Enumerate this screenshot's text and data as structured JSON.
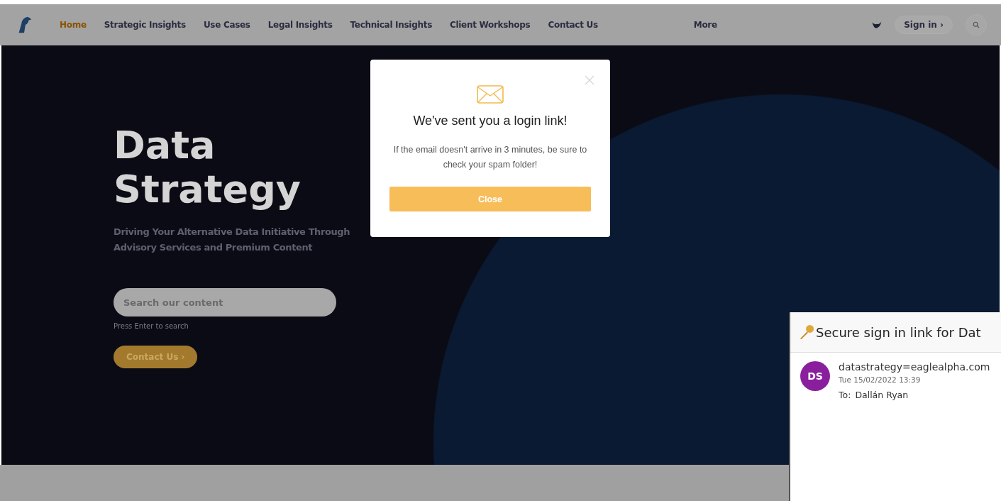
{
  "nav": {
    "items": [
      {
        "label": "Home",
        "selected": true
      },
      {
        "label": "Strategic Insights",
        "selected": false
      },
      {
        "label": "Use Cases",
        "selected": false
      },
      {
        "label": "Legal Insights",
        "selected": false
      },
      {
        "label": "Technical Insights",
        "selected": false
      },
      {
        "label": "Client Workshops",
        "selected": false
      },
      {
        "label": "Contact Us",
        "selected": false
      },
      {
        "label": "More",
        "selected": false
      }
    ],
    "sign_in": "Sign in ›"
  },
  "hero": {
    "title_lines": [
      "Data",
      "Strategy"
    ],
    "subtitle": "Driving Your Alternative Data Initiative Through Advisory Services and Premium Content",
    "search": {
      "placeholder": "Search our content"
    },
    "search_hint": "Press Enter to search",
    "contact_button": "Contact Us ›"
  },
  "modal": {
    "title": "We've sent you a login link!",
    "message": "If the email doesn't arrive in 3 minutes, be sure to check your spam folder!",
    "button": "Close"
  },
  "email": {
    "subject": "Secure sign in link for Dat",
    "avatar": "DS",
    "sender": "datastrategy=eaglealpha.com",
    "date": "Tue 15/02/2022 13:39",
    "to_label": "To:",
    "to": "Dallán Ryan"
  }
}
